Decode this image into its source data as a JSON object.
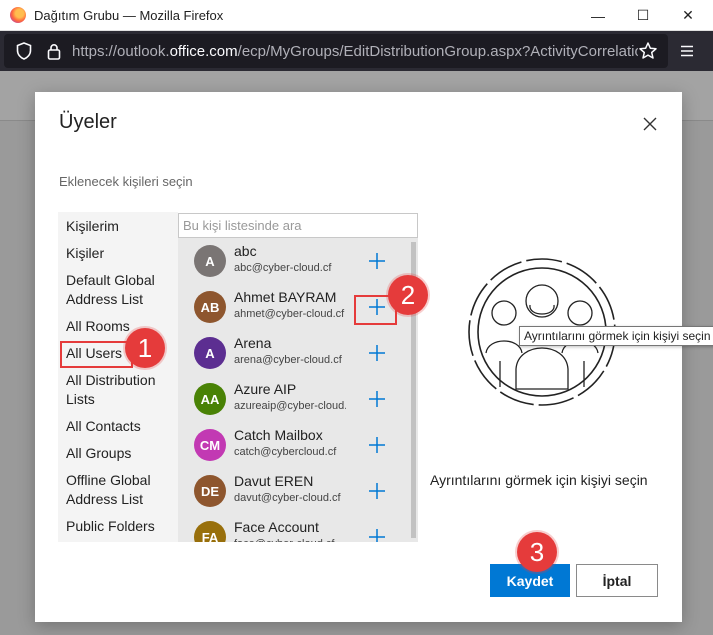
{
  "window": {
    "title": "Dağıtım Grubu — Mozilla Firefox",
    "minimize_glyph": "—",
    "maximize_glyph": "☐",
    "close_glyph": "✕"
  },
  "address_bar": {
    "url_prefix": "https://outlook.",
    "url_domain": "office.com",
    "url_path": "/ecp/MyGroups/EditDistributionGroup.aspx?ActivityCorrelationID=c"
  },
  "dialog": {
    "title": "Üyeler",
    "subtitle": "Eklenecek kişileri seçin",
    "search_placeholder": "Bu kişi listesinde ara",
    "details_message": "Ayrıntılarını görmek için kişiyi seçin",
    "tooltip": "Ayrıntılarını görmek için kişiyi seçin",
    "save_label": "Kaydet",
    "cancel_label": "İptal"
  },
  "leftnav": {
    "items": [
      {
        "label": "Kişilerim"
      },
      {
        "label": "Kişiler"
      },
      {
        "label": "Default Global Address List"
      },
      {
        "label": "All Rooms"
      },
      {
        "label": "All Users"
      },
      {
        "label": "All Distribution Lists"
      },
      {
        "label": "All Contacts"
      },
      {
        "label": "All Groups"
      },
      {
        "label": "Offline Global Address List"
      },
      {
        "label": "Public Folders"
      }
    ]
  },
  "people": [
    {
      "initials": "A",
      "name": "abc",
      "email": "abc@cyber-cloud.cf",
      "color": "#7a7574"
    },
    {
      "initials": "AB",
      "name": "Ahmet BAYRAM",
      "email": "ahmet@cyber-cloud.cf",
      "color": "#8e562e"
    },
    {
      "initials": "A",
      "name": "Arena",
      "email": "arena@cyber-cloud.cf",
      "color": "#5c2e91"
    },
    {
      "initials": "AA",
      "name": "Azure AIP",
      "email": "azureaip@cyber-cloud.cf",
      "color": "#498205"
    },
    {
      "initials": "CM",
      "name": "Catch Mailbox",
      "email": "catch@cybercloud.cf",
      "color": "#c239b3"
    },
    {
      "initials": "DE",
      "name": "Davut EREN",
      "email": "davut@cyber-cloud.cf",
      "color": "#8e562e"
    },
    {
      "initials": "FA",
      "name": "Face Account",
      "email": "face@cyber-cloud.cf",
      "color": "#986f0b"
    }
  ],
  "annotations": {
    "badge1": "1",
    "badge2": "2",
    "badge3": "3",
    "color": "#e53b3b"
  },
  "colors": {
    "accent": "#0078d4",
    "plus": "#0078d4"
  }
}
